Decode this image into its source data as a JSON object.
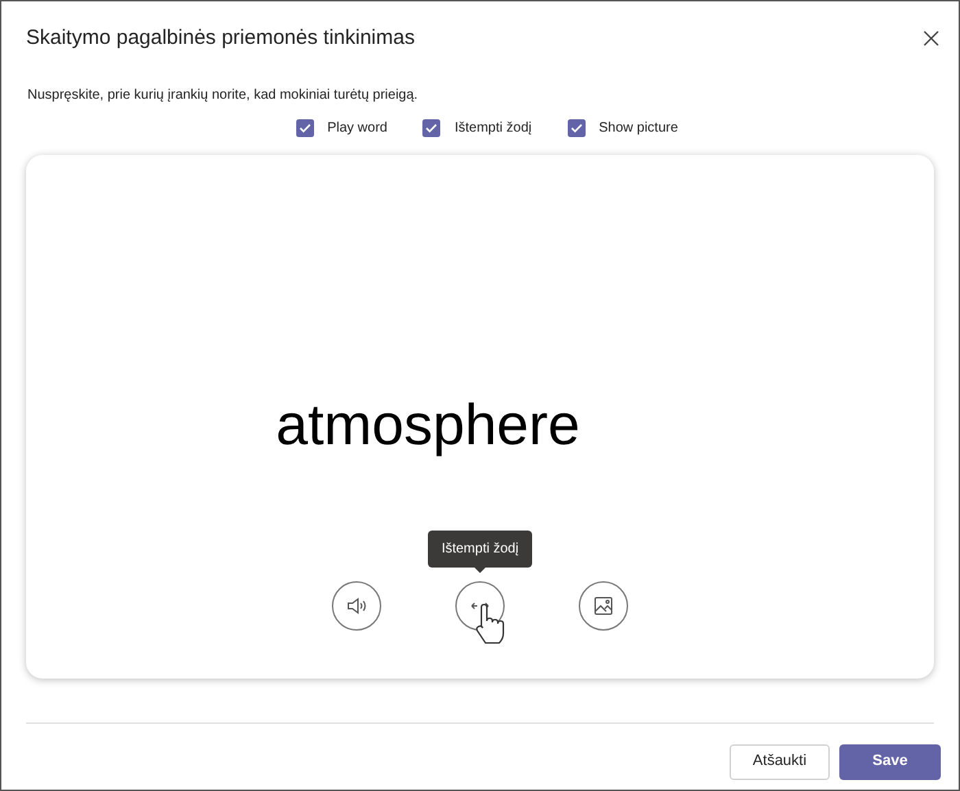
{
  "dialog": {
    "title": "Skaitymo pagalbinės priemonės tinkinimas",
    "instruction": "Nuspręskite, prie kurių įrankių norite, kad mokiniai turėtų prieigą."
  },
  "options": [
    {
      "label": "Play word",
      "checked": true
    },
    {
      "label": "Ištempti žodį",
      "checked": true
    },
    {
      "label": "Show picture",
      "checked": true
    }
  ],
  "preview": {
    "word": "atmosphere",
    "tools": [
      {
        "kind": "sound",
        "hovered": false
      },
      {
        "kind": "stretch",
        "hovered": true,
        "tooltip": "Ištempti žodį"
      },
      {
        "kind": "picture",
        "hovered": false
      }
    ]
  },
  "buttons": {
    "cancel": "Atšaukti",
    "save": "Save"
  }
}
